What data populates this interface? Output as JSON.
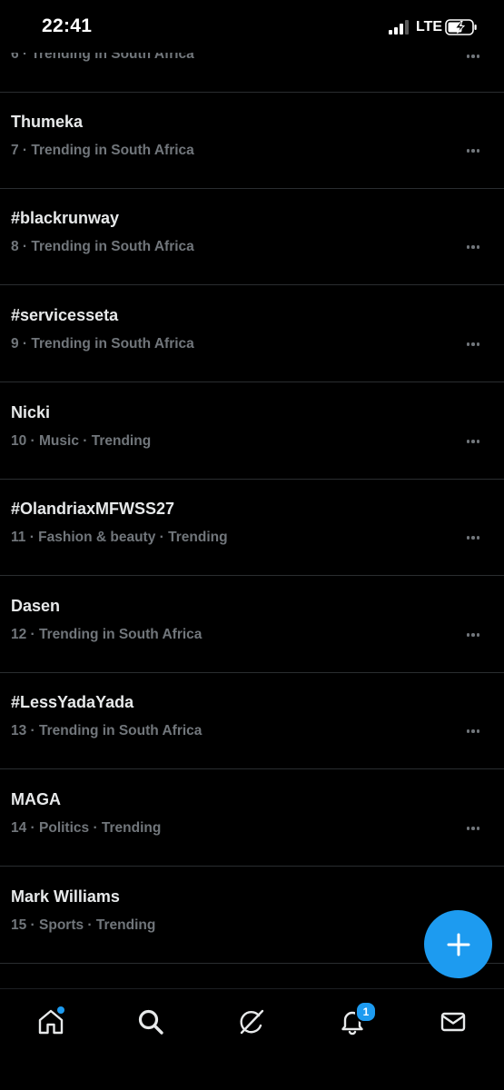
{
  "status_bar": {
    "time": "22:41",
    "network": "LTE"
  },
  "trends": [
    {
      "title": "",
      "meta": "6 · Trending in South Africa"
    },
    {
      "title": "Thumeka",
      "meta": "7 · Trending in South Africa"
    },
    {
      "title": "#blackrunway",
      "meta": "8 · Trending in South Africa"
    },
    {
      "title": "#servicesseta",
      "meta": "9 · Trending in South Africa"
    },
    {
      "title": "Nicki",
      "meta": "10 · Music · Trending"
    },
    {
      "title": "#OlandriaxMFWSS27",
      "meta": "11 · Fashion & beauty · Trending"
    },
    {
      "title": "Dasen",
      "meta": "12 · Trending in South Africa"
    },
    {
      "title": "#LessYadaYada",
      "meta": "13 · Trending in South Africa"
    },
    {
      "title": "MAGA",
      "meta": "14 · Politics · Trending"
    },
    {
      "title": "Mark Williams",
      "meta": "15 · Sports · Trending"
    }
  ],
  "bottom_nav": {
    "items": [
      {
        "icon": "home-icon",
        "active": true,
        "has_dot": true
      },
      {
        "icon": "search-icon"
      },
      {
        "icon": "grok-icon"
      },
      {
        "icon": "bell-icon",
        "badge": "1"
      },
      {
        "icon": "mail-icon"
      }
    ]
  },
  "colors": {
    "background": "#000000",
    "accent": "#1d9bf0",
    "primary_text": "#e7e9ea",
    "secondary_text": "#71767b",
    "divider": "#2a2d30"
  }
}
